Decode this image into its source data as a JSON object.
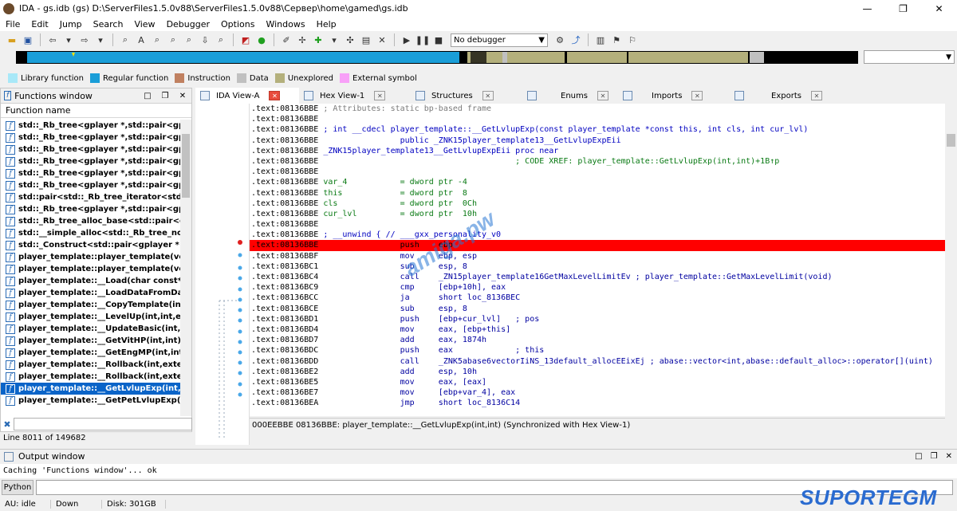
{
  "window": {
    "title": "IDA - gs.idb (gs) D:\\ServerFiles1.5.0v88\\ServerFiles1.5.0v88\\Сервер\\home\\gamed\\gs.idb",
    "controls": [
      "—",
      "❐",
      "✕"
    ]
  },
  "menu": [
    "File",
    "Edit",
    "Jump",
    "Search",
    "View",
    "Debugger",
    "Options",
    "Windows",
    "Help"
  ],
  "toolbar": {
    "debugger_select": "No debugger"
  },
  "legend": [
    {
      "label": "Library function",
      "color": "#a8e8f8"
    },
    {
      "label": "Regular function",
      "color": "#1a9ed8"
    },
    {
      "label": "Instruction",
      "color": "#c08060"
    },
    {
      "label": "Data",
      "color": "#c0c0c0"
    },
    {
      "label": "Unexplored",
      "color": "#b4b07c"
    },
    {
      "label": "External symbol",
      "color": "#f8a0f8"
    }
  ],
  "functions_window": {
    "title": "Functions window",
    "column": "Function name",
    "items": [
      "std::_Rb_tree<gplayer *,std::pair<gplay",
      "std::_Rb_tree<gplayer *,std::pair<gplay",
      "std::_Rb_tree<gplayer *,std::pair<gplayer * c",
      "std::_Rb_tree<gplayer *,std::pair<gplay",
      "std::_Rb_tree<gplayer *,std::pair<gplay",
      "std::_Rb_tree<gplayer *,std::pair<gplay",
      "std::pair<std::_Rb_tree_iterator<std::pa",
      "std::_Rb_tree<gplayer *,std::pair<gplay",
      "std::_Rb_tree_alloc_base<std::pair<gpl",
      "std::__simple_alloc<std::_Rb_tree_node",
      "std::_Construct<std::pair<gplayer * con",
      "player_template::player_template(void",
      "player_template::player_template(void",
      "player_template::__Load(char const*,it",
      "player_template::__LoadDataFromData",
      "player_template::__CopyTemplate(int,e",
      "player_template::__LevelUp(int,int,exte",
      "player_template::__UpdateBasic(int,ext",
      "player_template::__GetVitHP(int,int)",
      "player_template::__GetEngMP(int,int)",
      "player_template::__Rollback(int,extend",
      "player_template::__Rollback(int,extend",
      "player_template::__GetLvlupExp(int,int",
      "player_template::__GetPetLvlupExp(int"
    ],
    "selected_index": 22,
    "status": "Line 8011 of 149682"
  },
  "tabs": [
    {
      "label": "IDA View-A",
      "active": true
    },
    {
      "label": "Hex View-1",
      "active": false
    },
    {
      "label": "Structures",
      "active": false
    },
    {
      "label": "Enums",
      "active": false
    },
    {
      "label": "Imports",
      "active": false
    },
    {
      "label": "Exports",
      "active": false
    }
  ],
  "disasm": [
    {
      "addr": ".text:08136BBE",
      "rest": " ; Attributes: static bp-based frame",
      "type": "cmt"
    },
    {
      "addr": ".text:08136BBE",
      "rest": "",
      "type": "plain"
    },
    {
      "addr": ".text:08136BBE",
      "rest": " ; int __cdecl player_template::__GetLvlupExp(const player_template *const this, int cls, int cur_lvl)",
      "type": "kw"
    },
    {
      "addr": ".text:08136BBE",
      "rest": "                 public _ZNK15player_template13__GetLvlupExpEii",
      "type": "kw"
    },
    {
      "addr": ".text:08136BBE",
      "rest": " _ZNK15player_template13__GetLvlupExpEii proc near",
      "type": "kw"
    },
    {
      "addr": ".text:08136BBE",
      "rest": "                                         ; CODE XREF: player_template::GetLvlupExp(int,int)+1B↑p",
      "type": "nm"
    },
    {
      "addr": ".text:08136BBE",
      "rest": "",
      "type": "plain"
    },
    {
      "addr": ".text:08136BBE",
      "rest": " var_4           = dword ptr -4",
      "type": "nm"
    },
    {
      "addr": ".text:08136BBE",
      "rest": " this            = dword ptr  8",
      "type": "nm"
    },
    {
      "addr": ".text:08136BBE",
      "rest": " cls             = dword ptr  0Ch",
      "type": "nm"
    },
    {
      "addr": ".text:08136BBE",
      "rest": " cur_lvl         = dword ptr  10h",
      "type": "nm"
    },
    {
      "addr": ".text:08136BBE",
      "rest": "",
      "type": "plain"
    },
    {
      "addr": ".text:08136BBE",
      "rest": " ; __unwind { // ___gxx_personality_v0",
      "type": "kw"
    },
    {
      "addr": ".text:08136BBE",
      "rest": "                 push    ebp",
      "type": "hl"
    },
    {
      "addr": ".text:08136BBF",
      "rest": "                 mov     ebp, esp",
      "type": "mn"
    },
    {
      "addr": ".text:08136BC1",
      "rest": "                 sub     esp, 8",
      "type": "mn"
    },
    {
      "addr": ".text:08136BC4",
      "rest": "                 call    _ZN15player_template16GetMaxLevelLimitEv ; player_template::GetMaxLevelLimit(void)",
      "type": "mn"
    },
    {
      "addr": ".text:08136BC9",
      "rest": "                 cmp     [ebp+10h], eax",
      "type": "mn"
    },
    {
      "addr": ".text:08136BCC",
      "rest": "                 ja      short loc_8136BEC",
      "type": "mn"
    },
    {
      "addr": ".text:08136BCE",
      "rest": "                 sub     esp, 8",
      "type": "mn"
    },
    {
      "addr": ".text:08136BD1",
      "rest": "                 push    [ebp+cur_lvl]   ; pos",
      "type": "mn"
    },
    {
      "addr": ".text:08136BD4",
      "rest": "                 mov     eax, [ebp+this]",
      "type": "mn"
    },
    {
      "addr": ".text:08136BD7",
      "rest": "                 add     eax, 1874h",
      "type": "mn"
    },
    {
      "addr": ".text:08136BDC",
      "rest": "                 push    eax             ; this",
      "type": "mn"
    },
    {
      "addr": ".text:08136BDD",
      "rest": "                 call    _ZNK5abase6vectorIiNS_13default_allocEEixEj ; abase::vector<int,abase::default_alloc>::operator[](uint)",
      "type": "mn"
    },
    {
      "addr": ".text:08136BE2",
      "rest": "                 add     esp, 10h",
      "type": "mn"
    },
    {
      "addr": ".text:08136BE5",
      "rest": "                 mov     eax, [eax]",
      "type": "mn"
    },
    {
      "addr": ".text:08136BE7",
      "rest": "                 mov     [ebp+var_4], eax",
      "type": "mn"
    },
    {
      "addr": ".text:08136BEA",
      "rest": "                 jmp     short loc_8136C14",
      "type": "mn"
    }
  ],
  "disasm_status": "000EEBBE  08136BBE: player_template::__GetLvlupExp(int,int)  (Synchronized with Hex View-1)",
  "output": {
    "title": "Output window",
    "text": "Caching 'Functions window'... ok",
    "python_button": "Python"
  },
  "statusbar": [
    "AU:  idle",
    "Down",
    "Disk: 301GB"
  ],
  "watermarks": {
    "brand": "SUPORTEGM",
    "diagonal": "amiga.pw"
  }
}
